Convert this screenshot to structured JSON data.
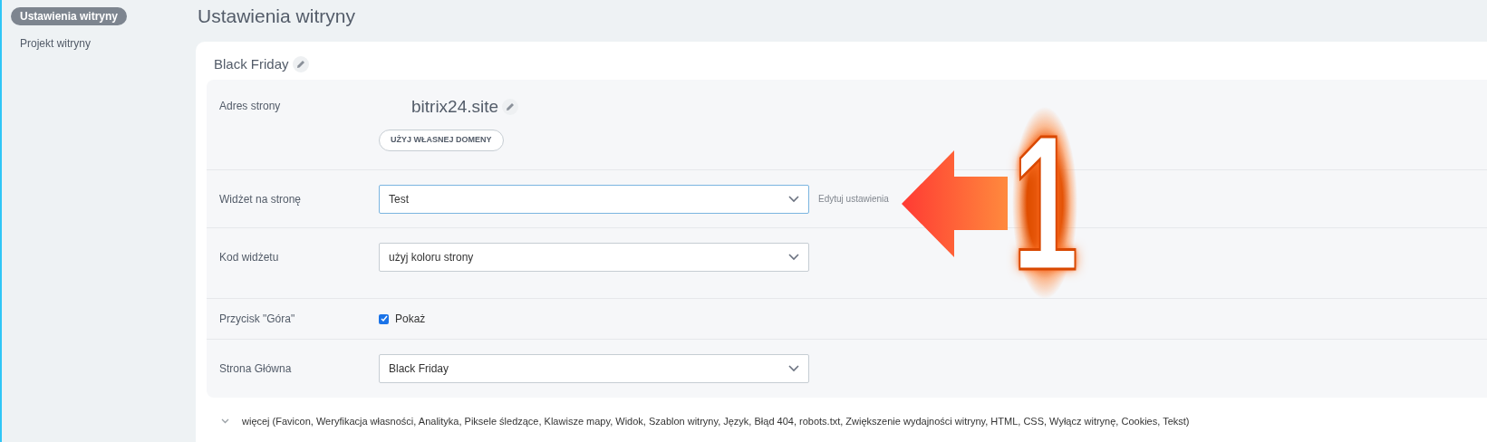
{
  "sidebar": {
    "items": [
      {
        "label": "Ustawienia witryny",
        "selected": true
      },
      {
        "label": "Projekt witryny",
        "selected": false
      }
    ]
  },
  "page_title": "Ustawienia witryny",
  "card": {
    "title": "Black Friday",
    "rows": [
      {
        "kind": "domain",
        "label": "Adres strony",
        "value": "bitrix24.site",
        "button": "UŻYJ WŁASNEJ DOMENY"
      },
      {
        "kind": "select",
        "label": "Widżet na stronę",
        "value": "Test",
        "focused": true,
        "link": "Edytuj ustawienia"
      },
      {
        "kind": "select",
        "label": "Kod widżetu",
        "value": "użyj koloru strony",
        "focused": false
      },
      {
        "kind": "checkbox",
        "label": "Przycisk \"Góra\"",
        "option": "Pokaż",
        "checked": true
      },
      {
        "kind": "select",
        "label": "Strona Główna",
        "value": "Black Friday",
        "focused": false
      }
    ],
    "more": "więcej (Favicon,  Weryfikacja własności,  Analityka,  Piksele śledzące,  Klawisze mapy,  Widok,  Szablon witryny,  Język,  Błąd 404,  robots.txt,  Zwiększenie wydajności witryny,  HTML,  CSS,  Wyłącz witrynę,  Cookies,  Tekst)"
  },
  "annotation": {
    "number": "1"
  }
}
